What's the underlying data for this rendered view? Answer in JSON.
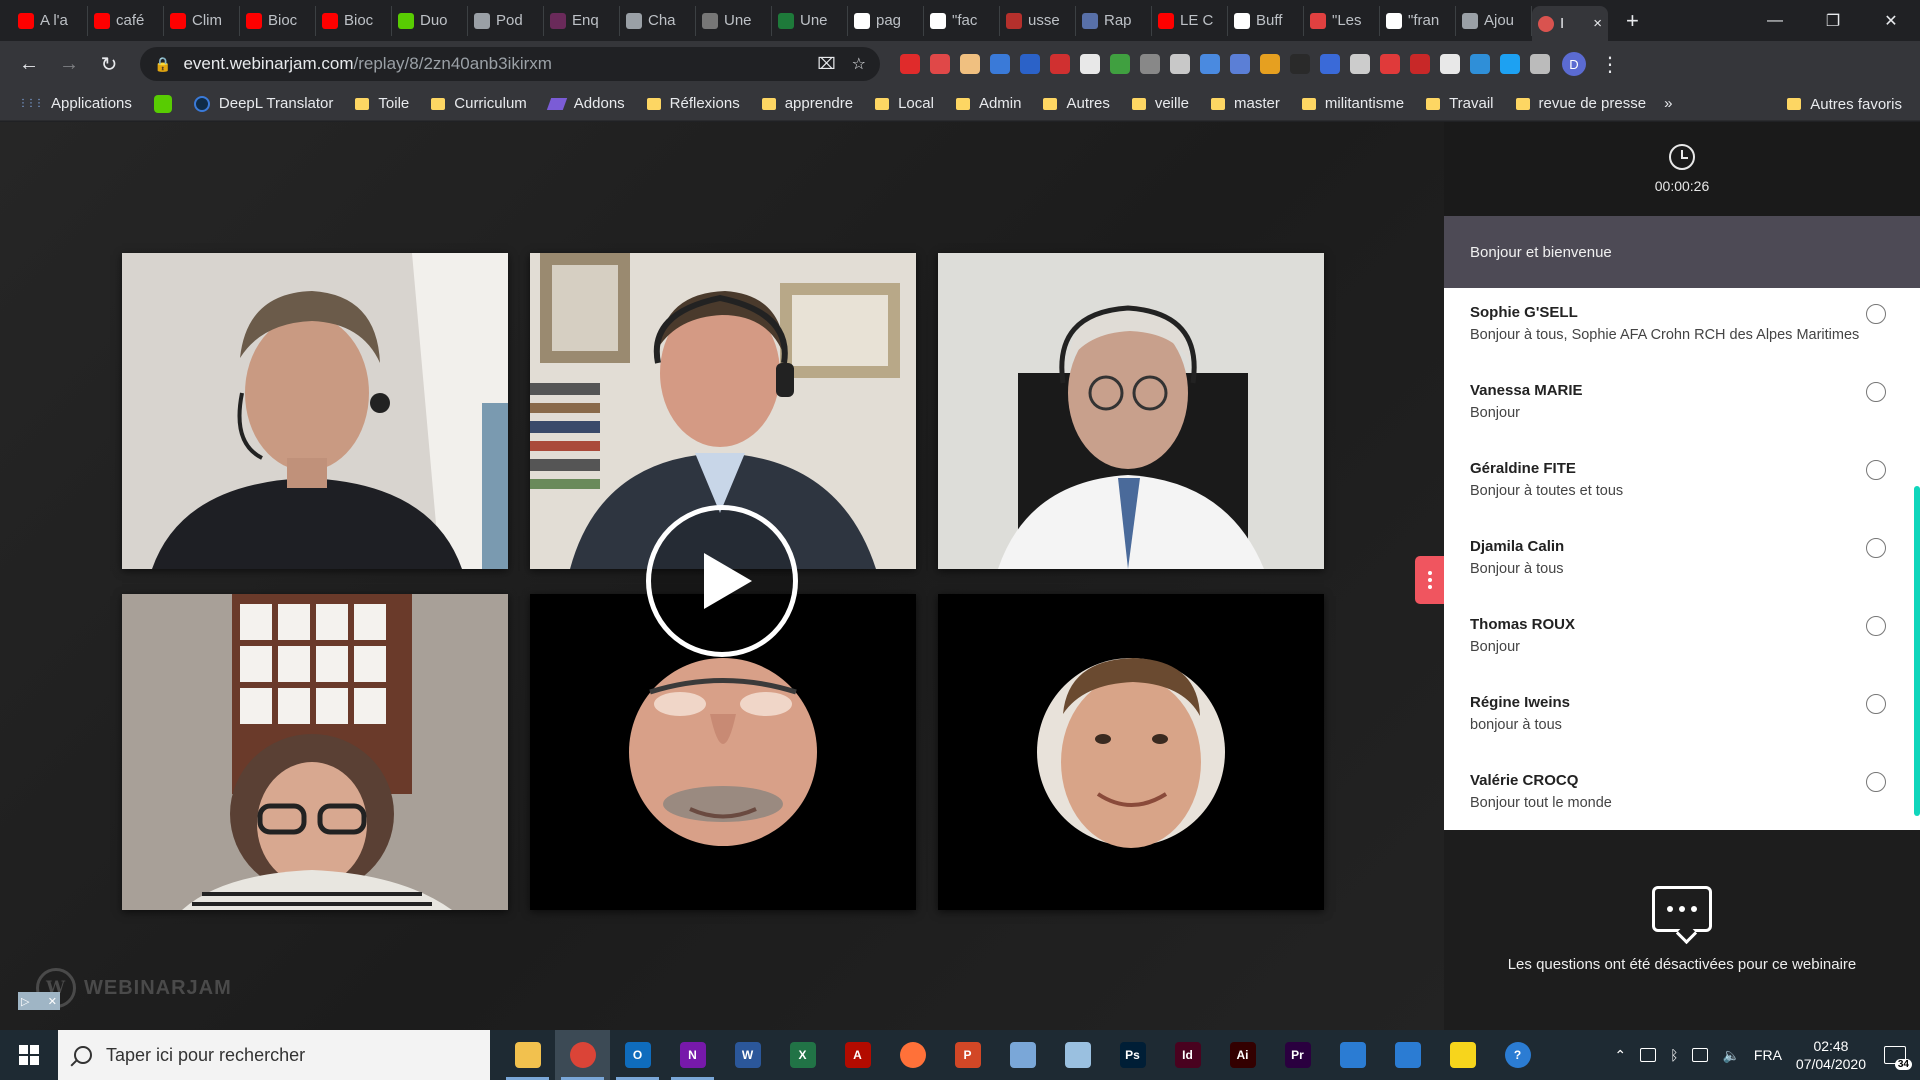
{
  "browser": {
    "tabs": [
      {
        "label": "A l'a",
        "fav": "#ff0000"
      },
      {
        "label": "café",
        "fav": "#ff0000"
      },
      {
        "label": "Clim",
        "fav": "#ff0000"
      },
      {
        "label": "Bioc",
        "fav": "#ff0000"
      },
      {
        "label": "Bioc",
        "fav": "#ff0000"
      },
      {
        "label": "Duo",
        "fav": "#58cc02"
      },
      {
        "label": "Pod",
        "fav": "#9aa0a6"
      },
      {
        "label": "Enq",
        "fav": "#6a2a5a"
      },
      {
        "label": "Cha",
        "fav": "#9aa0a6"
      },
      {
        "label": "Une",
        "fav": "#777777"
      },
      {
        "label": "Une",
        "fav": "#1e7a3a"
      },
      {
        "label": "pag",
        "fav": "#ffffff"
      },
      {
        "label": "\"fac",
        "fav": "#ffffff"
      },
      {
        "label": "usse",
        "fav": "#b5302c"
      },
      {
        "label": "Rap",
        "fav": "#5870a8"
      },
      {
        "label": "LE C",
        "fav": "#ff0000"
      },
      {
        "label": "Buff",
        "fav": "#ffffff"
      },
      {
        "label": "\"Les",
        "fav": "#e04040"
      },
      {
        "label": "\"fran",
        "fav": "#ffffff"
      },
      {
        "label": "Ajou",
        "fav": "#9aa0a6"
      }
    ],
    "active_tab": {
      "label": "I",
      "fav": "#d9534f",
      "close": "×"
    },
    "new_tab": "+",
    "window_controls": {
      "minimize": "—",
      "maximize": "❐",
      "close": "✕"
    },
    "nav": {
      "back": "←",
      "forward": "→",
      "reload": "↻"
    },
    "url_host": "event.webinarjam.com",
    "url_path": "/replay/8/2zn40anb3ikirxm",
    "omni_icons": {
      "translate": "⌧",
      "star": "☆"
    },
    "profile_initial": "D",
    "menu": "⋮",
    "extensions": [
      "#e02b2b",
      "#e04848",
      "#f0c080",
      "#3a7ad8",
      "#2b62c8",
      "#d03030",
      "#e8e8e8",
      "#40a040",
      "#888888",
      "#c8c8c8",
      "#4a8ae0",
      "#5b7fd6",
      "#e6a020",
      "#2a2a2a",
      "#3a6ad8",
      "#cccccc",
      "#e03a3a",
      "#c82828",
      "#e8e8e8",
      "#2f8fd8",
      "#1da1f2",
      "#bbbbbb"
    ]
  },
  "bookmarks": {
    "items": [
      {
        "label": "Applications",
        "kind": "apps"
      },
      {
        "label": "",
        "kind": "duo"
      },
      {
        "label": "DeepL Translator",
        "kind": "deepl"
      },
      {
        "label": "Toile",
        "kind": "folder"
      },
      {
        "label": "Curriculum",
        "kind": "folder"
      },
      {
        "label": "Addons",
        "kind": "addons"
      },
      {
        "label": "Réflexions",
        "kind": "folder"
      },
      {
        "label": "apprendre",
        "kind": "folder"
      },
      {
        "label": "Local",
        "kind": "folder"
      },
      {
        "label": "Admin",
        "kind": "folder"
      },
      {
        "label": "Autres",
        "kind": "folder"
      },
      {
        "label": "veille",
        "kind": "folder"
      },
      {
        "label": "master",
        "kind": "folder"
      },
      {
        "label": "militantisme",
        "kind": "folder"
      },
      {
        "label": "Travail",
        "kind": "folder"
      },
      {
        "label": "revue de presse",
        "kind": "folder"
      }
    ],
    "more": "»",
    "other": "Autres favoris"
  },
  "webinar": {
    "tiles": [
      {
        "name": "participant-1-video",
        "bg": "#cfcac4"
      },
      {
        "name": "participant-2-video",
        "bg": "#d8d4cc"
      },
      {
        "name": "participant-3-video",
        "bg": "#c8c8c4"
      },
      {
        "name": "participant-4-video",
        "bg": "#b8b2aa"
      },
      {
        "name": "participant-5-avatar",
        "bg": "#000000"
      },
      {
        "name": "participant-6-avatar",
        "bg": "#000000"
      }
    ],
    "brand": "WEBINARJAM",
    "brand_mark": "W"
  },
  "panel": {
    "timer": "00:00:26",
    "welcome": "Bonjour et bienvenue",
    "messages": [
      {
        "name": "Sophie G'SELL",
        "text": "Bonjour à tous, Sophie AFA Crohn RCH des Alpes Maritimes"
      },
      {
        "name": "Vanessa MARIE",
        "text": "Bonjour"
      },
      {
        "name": "Géraldine FITE",
        "text": "Bonjour à toutes et tous"
      },
      {
        "name": "Djamila Calin",
        "text": "Bonjour à tous"
      },
      {
        "name": "Thomas ROUX",
        "text": "Bonjour"
      },
      {
        "name": "Régine Iweins",
        "text": "bonjour à tous"
      },
      {
        "name": "Valérie CROCQ",
        "text": "Bonjour tout le monde"
      }
    ],
    "questions_disabled": "Les questions ont été désactivées pour ce webinaire",
    "accent": "#f0555f",
    "scroll_color": "#10d6bc"
  },
  "taskbar": {
    "search_placeholder": "Taper ici pour rechercher",
    "apps": [
      {
        "name": "file-explorer",
        "color": "#f2c14e",
        "glyph": "",
        "open": true
      },
      {
        "name": "chrome",
        "color": "#db4437",
        "glyph": "",
        "open": true,
        "active": true
      },
      {
        "name": "outlook",
        "color": "#0f6cbd",
        "glyph": "O",
        "open": true
      },
      {
        "name": "onenote",
        "color": "#7719aa",
        "glyph": "N",
        "open": true
      },
      {
        "name": "word",
        "color": "#2b579a",
        "glyph": "W",
        "open": false
      },
      {
        "name": "excel",
        "color": "#217346",
        "glyph": "X",
        "open": false
      },
      {
        "name": "acrobat",
        "color": "#b30b00",
        "glyph": "A",
        "open": false
      },
      {
        "name": "firefox",
        "color": "#ff7139",
        "glyph": "",
        "open": false
      },
      {
        "name": "powerpoint",
        "color": "#d24726",
        "glyph": "P",
        "open": false
      },
      {
        "name": "control-panel",
        "color": "#7aa7d8",
        "glyph": "",
        "open": false
      },
      {
        "name": "paint",
        "color": "#9ac0e0",
        "glyph": "",
        "open": false
      },
      {
        "name": "photoshop",
        "color": "#001e36",
        "glyph": "Ps",
        "open": false
      },
      {
        "name": "indesign",
        "color": "#49021f",
        "glyph": "Id",
        "open": false
      },
      {
        "name": "illustrator",
        "color": "#330000",
        "glyph": "Ai",
        "open": false
      },
      {
        "name": "premiere",
        "color": "#2a003f",
        "glyph": "Pr",
        "open": false
      },
      {
        "name": "people",
        "color": "#2b7cd3",
        "glyph": "",
        "open": false
      },
      {
        "name": "store",
        "color": "#2b7cd3",
        "glyph": "",
        "open": false
      },
      {
        "name": "sticky-notes",
        "color": "#f7d51c",
        "glyph": "",
        "open": false
      },
      {
        "name": "help",
        "color": "#2b7cd3",
        "glyph": "?",
        "open": false
      }
    ],
    "language": "FRA",
    "time": "02:48",
    "date": "07/04/2020",
    "notifications": "34"
  }
}
